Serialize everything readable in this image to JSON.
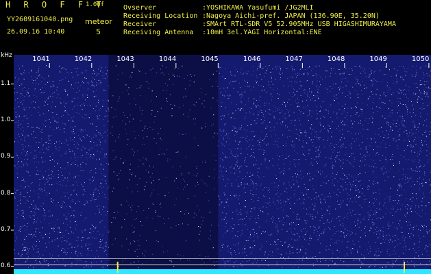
{
  "header": {
    "app_title": "H R O F F T",
    "version": "1.00f",
    "filename": "YY2609161040.png",
    "datetime": "26.09.16 10:40",
    "meteor_label": "meteor",
    "meteor_count": "5",
    "info": [
      {
        "key": "Ovserver",
        "value": ":YOSHIKAWA Yasufumi /JG2MLI"
      },
      {
        "key": "Receiving Location",
        "value": ":Nagoya Aichi-pref. JAPAN (136.90E, 35.20N)"
      },
      {
        "key": "Receiver",
        "value": ":SMArt RTL-SDR V5 52.905MHz USB HIGASHIMURAYAMA"
      },
      {
        "key": "Receiving Antenna",
        "value": ":10mH 3el.YAGI Horizontal:ENE"
      }
    ]
  },
  "colors": {
    "text_yellow": "#f2ee4a",
    "background": "#141a6e",
    "noise_dot": "#ffffff",
    "signal_cyan": "#2ee6ff"
  },
  "chart_data": {
    "type": "heatmap",
    "xlabel": "",
    "ylabel": "kHz",
    "x_ticks": [
      "1041",
      "1042",
      "1043",
      "1044",
      "1045",
      "1046",
      "1047",
      "1048",
      "1049",
      "1050"
    ],
    "y_ticks": [
      "1.1",
      "1.0",
      "0.9",
      "0.8",
      "0.7",
      "0.6"
    ],
    "ylim": [
      0.58,
      1.18
    ],
    "dark_band_minutes": [
      1042.4,
      1045.0
    ],
    "meteor_marks_minutes": [
      1042.6,
      1049.4
    ]
  }
}
